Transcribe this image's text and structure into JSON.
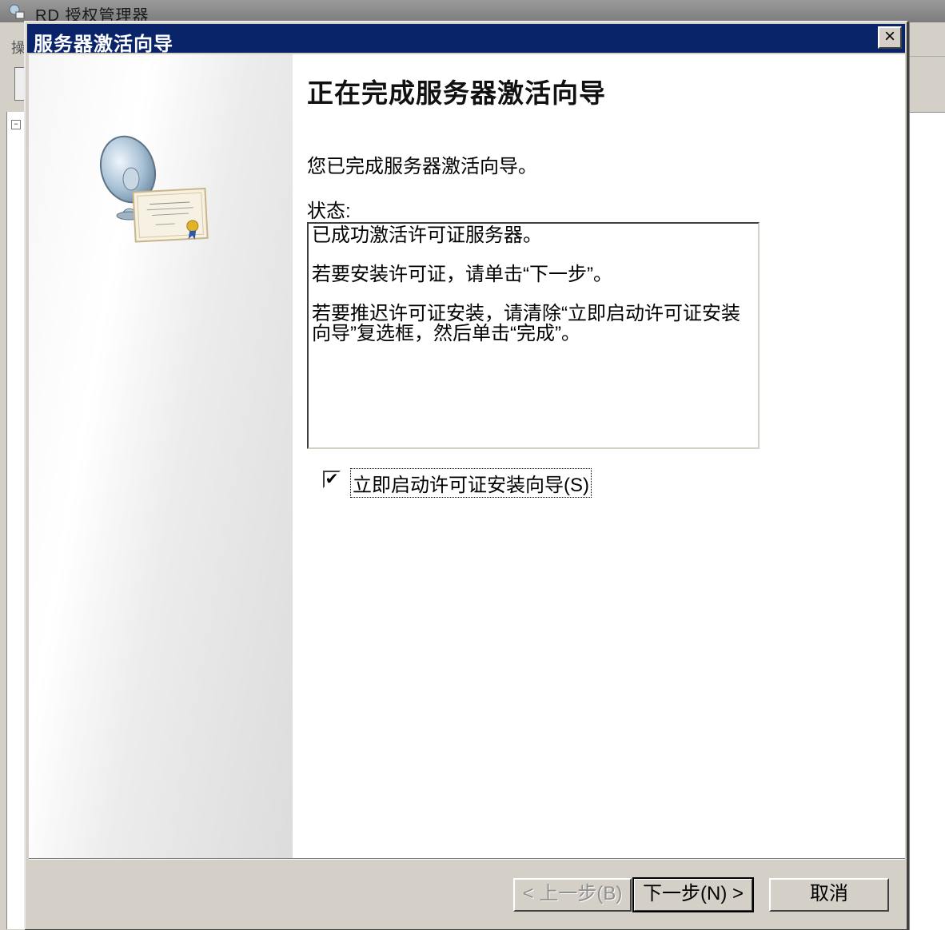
{
  "background_window": {
    "title": "RD 授权管理器",
    "menu_char": "操"
  },
  "dialog": {
    "title": "服务器激活向导",
    "close_glyph": "×"
  },
  "content": {
    "heading": "正在完成服务器激活向导",
    "intro": "您已完成服务器激活向导。",
    "status_label": "状态:",
    "status_lines": [
      "已成功激活许可证服务器。",
      "若要安装许可证，请单击“下一步”。",
      "若要推迟许可证安装，请清除“立即启动许可证安装向导”复选框，然后单击“完成”。"
    ]
  },
  "checkbox": {
    "label": "立即启动许可证安装向导(S)",
    "checked": true,
    "check_glyph": "✔"
  },
  "buttons": {
    "back": "< 上一步(B)",
    "next": "下一步(N) >",
    "cancel": "取消"
  },
  "icons": {
    "wizard_art": "satellite-dish-certificate-icon",
    "app_icon": "rd-licensing-icon"
  }
}
